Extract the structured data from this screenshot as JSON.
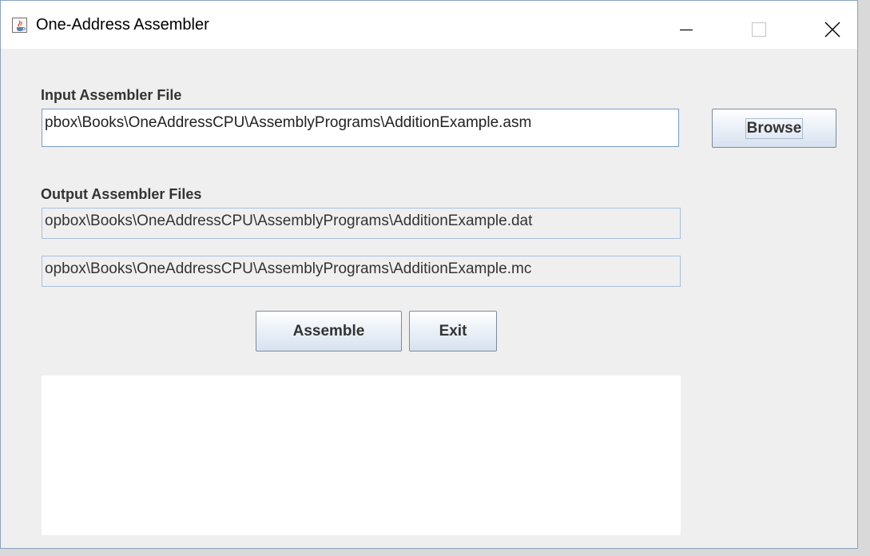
{
  "window": {
    "title": "One-Address Assembler"
  },
  "titlebar": {
    "app_icon": "java-cup-icon",
    "minimize_icon": "minimize-icon",
    "maximize_icon": "maximize-icon",
    "close_icon": "close-icon"
  },
  "input_section": {
    "label": "Input Assembler File",
    "file_value": "pbox\\Books\\OneAddressCPU\\AssemblyPrograms\\AdditionExample.asm",
    "browse_label": "Browse"
  },
  "output_section": {
    "label": "Output Assembler Files",
    "data_file_value": "opbox\\Books\\OneAddressCPU\\AssemblyPrograms\\AdditionExample.dat",
    "machine_code_file_value": "opbox\\Books\\OneAddressCPU\\AssemblyPrograms\\AdditionExample.mc"
  },
  "actions": {
    "assemble_label": "Assemble",
    "exit_label": "Exit"
  },
  "log": {
    "content": ""
  },
  "colors": {
    "window_bg": "#efefef",
    "field_border": "#7a9cc8",
    "button_gradient_bottom": "#d7e2ef",
    "label_text": "#333333"
  }
}
